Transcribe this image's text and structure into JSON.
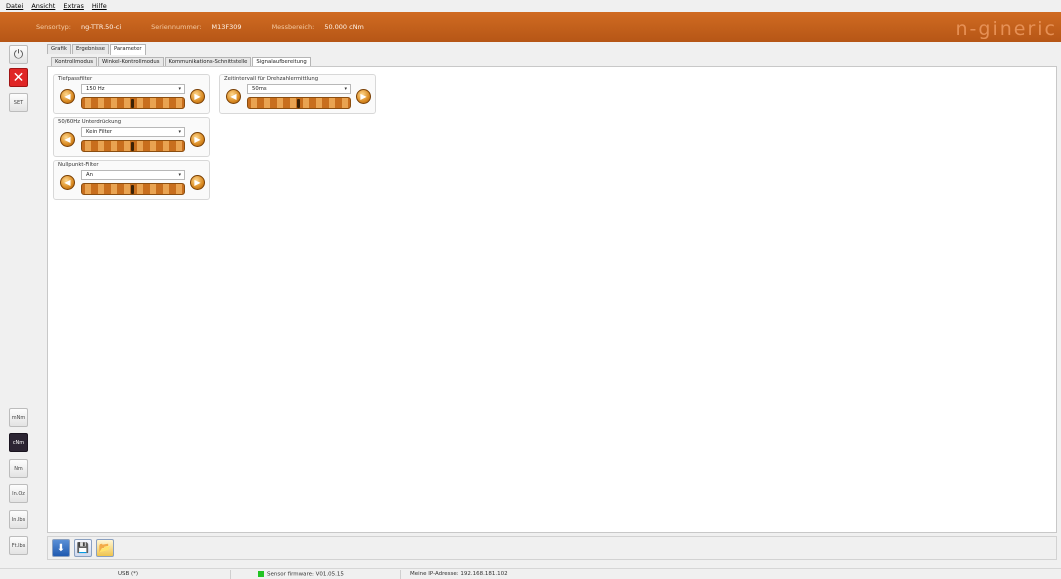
{
  "menu": {
    "items": [
      "Datei",
      "Ansicht",
      "Extras",
      "Hilfe"
    ]
  },
  "header": {
    "sensortyp_label": "Sensortyp:",
    "sensortyp_value": "ng-TTR.50-ci",
    "seriennummer_label": "Seriennummer:",
    "seriennummer_value": "M13F309",
    "messbereich_label": "Messbereich:",
    "messbereich_value": "50.000 cNm",
    "logo": "n-gineric",
    "color": "#c5621b"
  },
  "left_toolbar": {
    "top_buttons": [
      {
        "icon": "power-icon",
        "label": "⏻"
      },
      {
        "icon": "close-icon",
        "label": "✕"
      },
      {
        "icon": "set-icon",
        "label": "SET"
      }
    ],
    "units": [
      "mNm",
      "cNm",
      "Nm",
      "In.Oz",
      "In.lbs",
      "Ft.lbs"
    ],
    "active_unit": "cNm"
  },
  "tabs_main": [
    "Grafik",
    "Ergebnisse",
    "Parameter"
  ],
  "tabs_main_selected": "Parameter",
  "tabs_sub": [
    "Kontrollmodus",
    "Winkel-Kontrollmodus",
    "Kommunikations-Schnittstelle",
    "Signalaufbereitung"
  ],
  "tabs_sub_selected": "Signalaufbereitung",
  "groups": {
    "tiefpass": {
      "title": "Tiefpassfilter",
      "value": "150 Hz",
      "level": 0.5
    },
    "unterdrueckung": {
      "title": "50/60Hz Unterdrückung",
      "value": "Kein Filter",
      "level": 0.5
    },
    "nullpunkt": {
      "title": "Nullpunkt-Filter",
      "value": "An",
      "level": 0.5
    },
    "zeitintervall": {
      "title": "Zeitintervall für Drehzahlermittlung",
      "value": "50ms",
      "level": 0.5
    }
  },
  "arrows": {
    "left": "◀",
    "right": "▶"
  },
  "bottom_toolbar": {
    "download": "⬇",
    "save": "💾",
    "open": "📂"
  },
  "status": {
    "usb": "USB (*)",
    "firmware": "Sensor firmware: V01.05.15",
    "ip": "Meine IP-Adresse: 192.168.181.102",
    "led_color": "#22c322"
  }
}
